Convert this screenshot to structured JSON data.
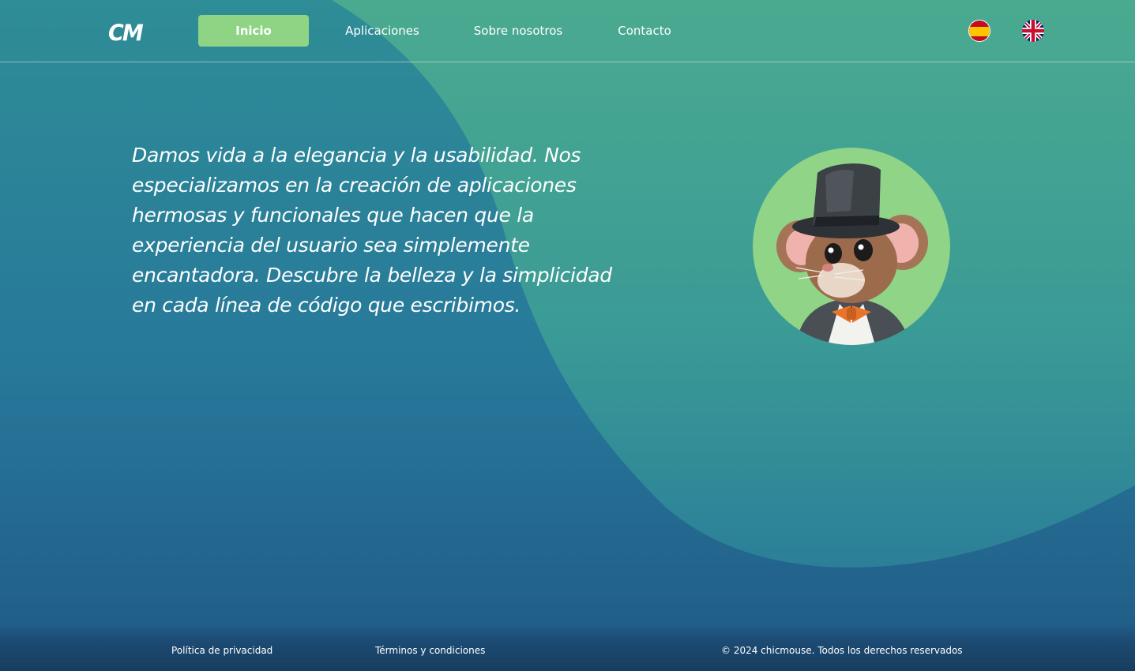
{
  "header": {
    "logo": "CM",
    "nav": [
      {
        "label": "Inicio",
        "active": true
      },
      {
        "label": "Aplicaciones",
        "active": false
      },
      {
        "label": "Sobre nosotros",
        "active": false
      },
      {
        "label": "Contacto",
        "active": false
      }
    ],
    "languages": [
      {
        "icon": "spain-flag-icon"
      },
      {
        "icon": "uk-flag-icon"
      }
    ]
  },
  "hero": {
    "text": "Damos vida a la elegancia y la usabilidad. Nos especializamos en la creación de aplicaciones hermosas y funcionales que hacen que la experiencia del usuario sea simplemente encantadora. Descubre la belleza y la simplicidad en cada línea de código que escribimos.",
    "image": "mouse-with-top-hat-mascot"
  },
  "footer": {
    "privacy": "Política de privacidad",
    "terms": "Términos y condiciones",
    "copyright": "© 2024 chicmouse. Todos los derechos reservados"
  },
  "colors": {
    "accent": "#8ed484",
    "background_top": "#2e8d96",
    "background_bottom": "#205a86",
    "wave": "#4aa98f"
  }
}
